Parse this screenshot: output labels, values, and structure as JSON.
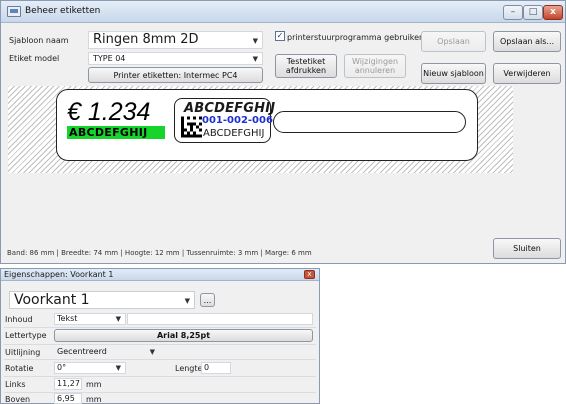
{
  "window": {
    "title": "Beheer etiketten",
    "min": "–",
    "max": "□",
    "close": "x"
  },
  "form": {
    "sjabloon_label": "Sjabloon naam",
    "sjabloon_value": "Ringen 8mm 2D",
    "etiket_label": "Etiket model",
    "etiket_value": "TYPE 04",
    "printer_button": "Printer etiketten: Intermec PC4",
    "checkbox_checked": true,
    "checkbox_label": "printerstuurprogramma gebruiken"
  },
  "buttons": {
    "testetiket": [
      "Testetiket",
      "afdrukken"
    ],
    "wijzigingen": [
      "Wijzigingen",
      "annuleren"
    ],
    "opslaan": "Opslaan",
    "opslaan_als": "Opslaan als...",
    "nieuw": "Nieuw sjabloon",
    "verwijderen": "Verwijderen",
    "sluiten": "Sluiten"
  },
  "label": {
    "price": "€ 1.234",
    "green_text": "ABCDEFGHIJ",
    "top_text": "ABCDEFGHIJ",
    "code": "001-002-006",
    "bottom_text": "ABCDEFGHIJ"
  },
  "status": "Band: 86 mm | Breedte: 74 mm | Hoogte: 12 mm | Tussenruimte: 3 mm | Marge: 6 mm",
  "panel": {
    "title": "Eigenschappen: Voorkant 1",
    "name": "Voorkant 1",
    "browse": "...",
    "inhoud_label": "Inhoud",
    "inhoud_value": "Tekst",
    "lettertype_label": "Lettertype",
    "lettertype_value": "Arial 8,25pt",
    "uitlijning_label": "Uitlijning",
    "uitlijning_value": "Gecentreerd",
    "rotatie_label": "Rotatie",
    "rotatie_value": "0°",
    "lengte_label": "Lengte",
    "lengte_value": "0",
    "links_label": "Links",
    "links_value": "11,27",
    "boven_label": "Boven",
    "boven_value": "6,95",
    "unit": "mm"
  }
}
